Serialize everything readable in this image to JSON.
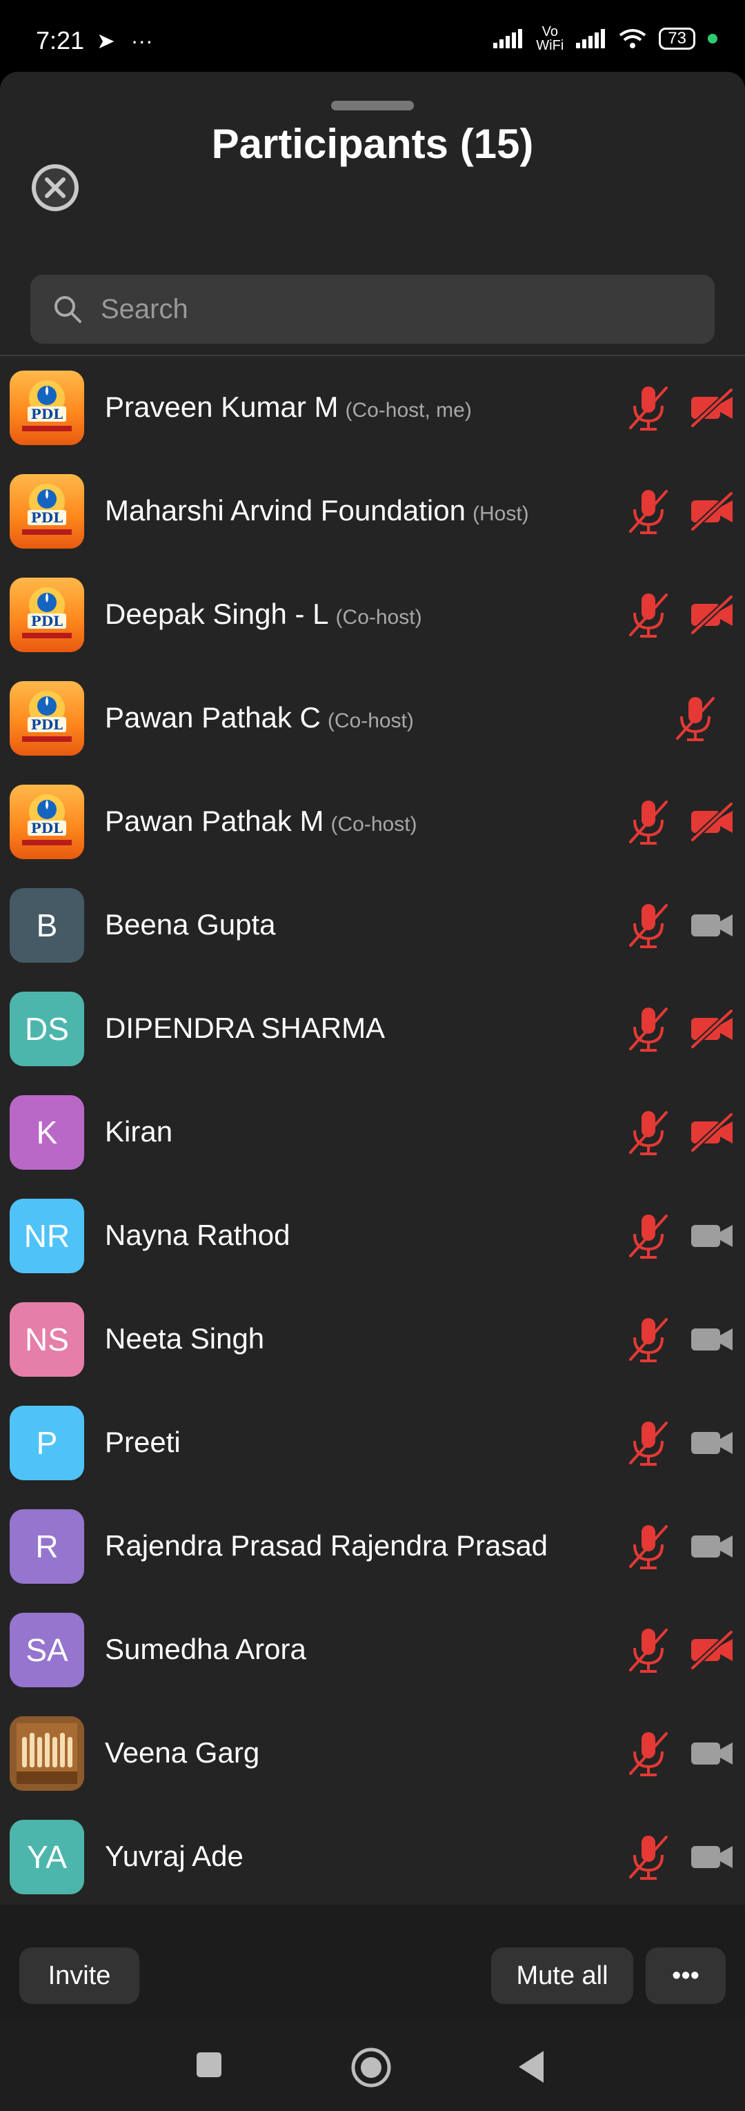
{
  "status_bar": {
    "time": "7:21",
    "icons_left": [
      "telegram-icon",
      "more-dots-icon"
    ],
    "network_label": "Vo WiFi",
    "battery": "73"
  },
  "sheet": {
    "title": "Participants (15)",
    "search_placeholder": "Search"
  },
  "participants": [
    {
      "name": "Praveen Kumar M",
      "role": "(Co-host, me)",
      "avatar": "logo-pdl",
      "mic": "muted",
      "video": "off"
    },
    {
      "name": "Maharshi Arvind Foundation",
      "role": "(Host)",
      "avatar": "logo-pdl",
      "mic": "muted",
      "video": "off"
    },
    {
      "name": "Deepak Singh - L",
      "role": "(Co-host)",
      "avatar": "logo-pdl",
      "mic": "muted",
      "video": "off"
    },
    {
      "name": "Pawan Pathak C",
      "role": "(Co-host)",
      "avatar": "logo-pdl",
      "mic": "muted",
      "video": "none"
    },
    {
      "name": "Pawan Pathak M",
      "role": "(Co-host)",
      "avatar": "logo-pdl",
      "mic": "muted",
      "video": "off"
    },
    {
      "name": "Beena Gupta",
      "role": "",
      "avatar_initials": "B",
      "avatar_color": "#455a64",
      "mic": "muted",
      "video": "available"
    },
    {
      "name": "DIPENDRA SHARMA",
      "role": "",
      "avatar_initials": "DS",
      "avatar_color": "#4db6ac",
      "mic": "muted",
      "video": "off"
    },
    {
      "name": "Kiran",
      "role": "",
      "avatar_initials": "K",
      "avatar_color": "#ba68c8",
      "mic": "muted",
      "video": "off"
    },
    {
      "name": "Nayna Rathod",
      "role": "",
      "avatar_initials": "NR",
      "avatar_color": "#4fc3f7",
      "mic": "muted",
      "video": "available"
    },
    {
      "name": "Neeta Singh",
      "role": "",
      "avatar_initials": "NS",
      "avatar_color": "#e57ea8",
      "mic": "muted",
      "video": "available"
    },
    {
      "name": "Preeti",
      "role": "",
      "avatar_initials": "P",
      "avatar_color": "#4fc3f7",
      "mic": "muted",
      "video": "available"
    },
    {
      "name": "Rajendra  Prasad Rajendra Prasad",
      "role": "",
      "avatar_initials": "R",
      "avatar_color": "#9575cd",
      "mic": "muted",
      "video": "available"
    },
    {
      "name": "Sumedha Arora",
      "role": "",
      "avatar_initials": "SA",
      "avatar_color": "#9575cd",
      "mic": "muted",
      "video": "off"
    },
    {
      "name": "Veena Garg",
      "role": "",
      "avatar": "photo-organ",
      "mic": "muted",
      "video": "available"
    },
    {
      "name": "Yuvraj Ade",
      "role": "",
      "avatar_initials": "YA",
      "avatar_color": "#4db6ac",
      "mic": "muted",
      "video": "available"
    }
  ],
  "footer": {
    "invite_label": "Invite",
    "mute_all_label": "Mute all",
    "more_label": "•••"
  },
  "colors": {
    "muted_red": "#e53935",
    "sheet_bg": "#242424",
    "video_gray": "#9e9e9e"
  }
}
